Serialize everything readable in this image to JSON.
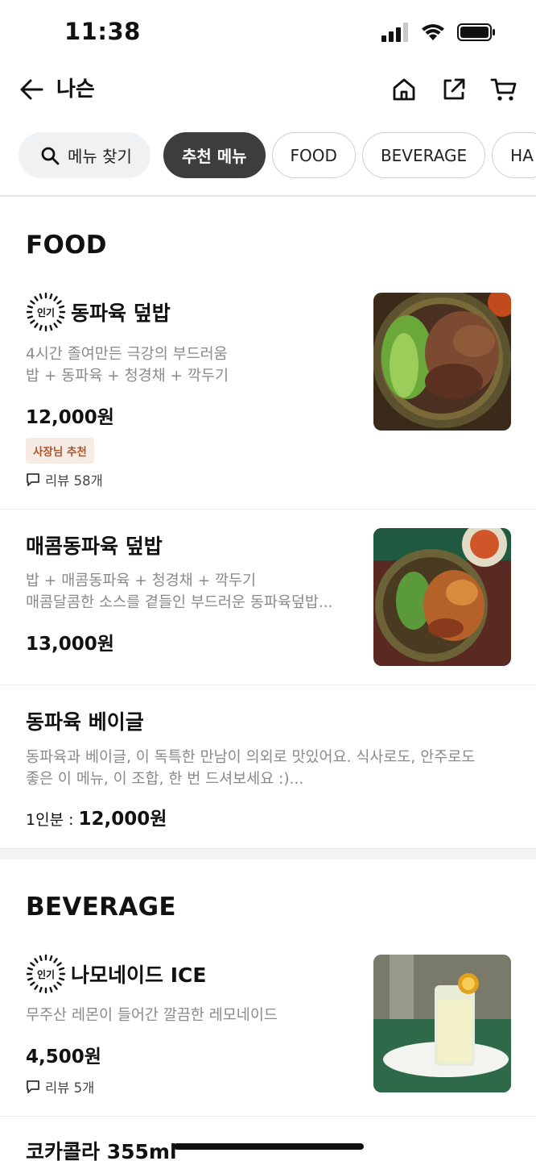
{
  "status_bar": {
    "time": "11:38"
  },
  "nav": {
    "title": "나슨"
  },
  "chips": [
    {
      "label": "메뉴 찾기"
    },
    {
      "label": "추천 메뉴",
      "active": true
    },
    {
      "label": "FOOD"
    },
    {
      "label": "BEVERAGE"
    },
    {
      "label": "HA"
    }
  ],
  "sections": [
    {
      "title": "FOOD",
      "items": [
        {
          "badge": "인기",
          "name": "동파육 덮밥",
          "desc_lines": [
            "4시간 졸여만든 극강의 부드러움",
            "밥 + 동파육 + 청경채  + 깍두기"
          ],
          "price": "12,000원",
          "tag": "사장님 추천",
          "review": "리뷰 58개"
        },
        {
          "name": "매콤동파육 덮밥",
          "desc_lines": [
            "밥 + 매콤동파육 + 청경채 + 깍두기",
            "매콤달콤한 소스를 곁들인 부드러운 동파육덮밥..."
          ],
          "price": "13,000원"
        },
        {
          "name": "동파육 베이글",
          "desc_lines": [
            "동파육과 베이글, 이 독특한 만남이 의외로 맛있어요. 식사로도, 안주로도",
            "좋은 이 메뉴, 이 조합, 한 번 드셔보세요 :)..."
          ],
          "price_prefix": "1인분 : ",
          "price": "12,000원"
        }
      ]
    },
    {
      "title": "BEVERAGE",
      "items": [
        {
          "badge": "인기",
          "name": "나모네이드 ICE",
          "desc_lines": [
            "무주산 레몬이 들어간 깔끔한 레모네이드"
          ],
          "price": "4,500원",
          "review": "리뷰 5개"
        },
        {
          "name": "코카콜라 355ml"
        }
      ]
    }
  ],
  "colors": {
    "accent_chip": "#3d3d3d",
    "tag_text": "#b0552a",
    "tag_bg": "#f6ece5"
  }
}
